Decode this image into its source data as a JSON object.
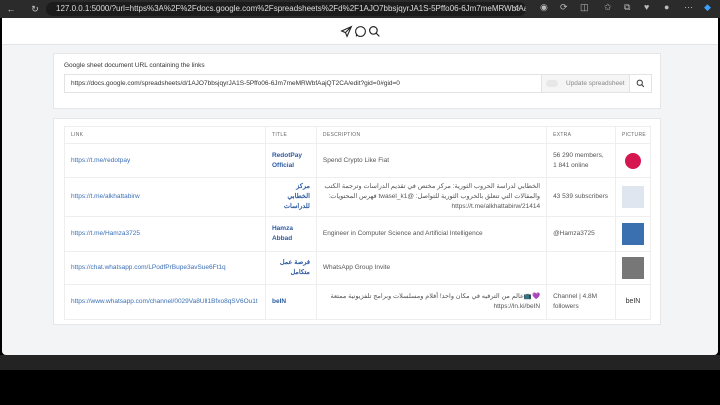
{
  "browser": {
    "url": "127.0.0.1:5000/?url=https%3A%2F%2Fdocs.google.com%2Fspreadsheets%2Fd%2F1AJO7bbsjqyrJA1S-5Pffo06-6Jm7meMRWbfAajQ..."
  },
  "form": {
    "label": "Google sheet document URL containing the links",
    "url_value": "https://docs.google.com/spreadsheets/d/1AJO7bbsjqyrJA1S-5Pffo06-6Jm7meMRWbfAajQT2CA/edit?gid=0#gid=0",
    "update_label": "Update spreadsheet"
  },
  "table": {
    "headers": [
      "LINK",
      "TITLE",
      "DESCRIPTION",
      "EXTRA",
      "PICTURE"
    ],
    "rows": [
      {
        "link": "https://t.me/redotpay",
        "title": "RedotPay Official",
        "description": "Spend Crypto Like Fiat",
        "extra": "56 290 members, 1 841 online",
        "picture": "redotpay-logo",
        "color": "#d6164f"
      },
      {
        "link": "https://t.me/alkhattabirw",
        "title": "مركز الخطابي للدراسات",
        "description": "الخطابي لدراسة الحروب الثورية: مركز مختص في تقديم الدراسات وترجمة الكتب والمقالات التي تتعلق بالحروب الثورية للتواصل: @twasel_k1 فهرس المحتويات: https://t.me/alkhattabirw/21414",
        "extra": "43 539 subscribers",
        "picture": "calligraphy-logo",
        "color": "#dfe6ef"
      },
      {
        "link": "https://t.me/Hamza3725",
        "title": "Hamza Abbad",
        "description": "Engineer in Computer Science and Artificial Intelligence",
        "extra": "@Hamza3725",
        "picture": "avatar-photo",
        "color": "#3a6fb0"
      },
      {
        "link": "https://chat.whatsapp.com/LPodfPrBupe3avSue6Ft1q",
        "title": "فرصة عمل متكامل",
        "description": "WhatsApp Group Invite",
        "extra": "",
        "picture": "group-photo",
        "color": "#777777"
      },
      {
        "link": "https://www.whatsapp.com/channel/0029Va8Ull1Bfxo8qSV6Ou1t",
        "title": "beIN",
        "description": "💜📺عالم من الترفيه في مكان واحد! أفلام ومسلسلات وبرامج تلفزيونية ممتعة https://ln.ki/beIN",
        "extra": "Channel | 4.8M followers",
        "picture": "bein-logo",
        "color": "#ffffff"
      }
    ]
  }
}
